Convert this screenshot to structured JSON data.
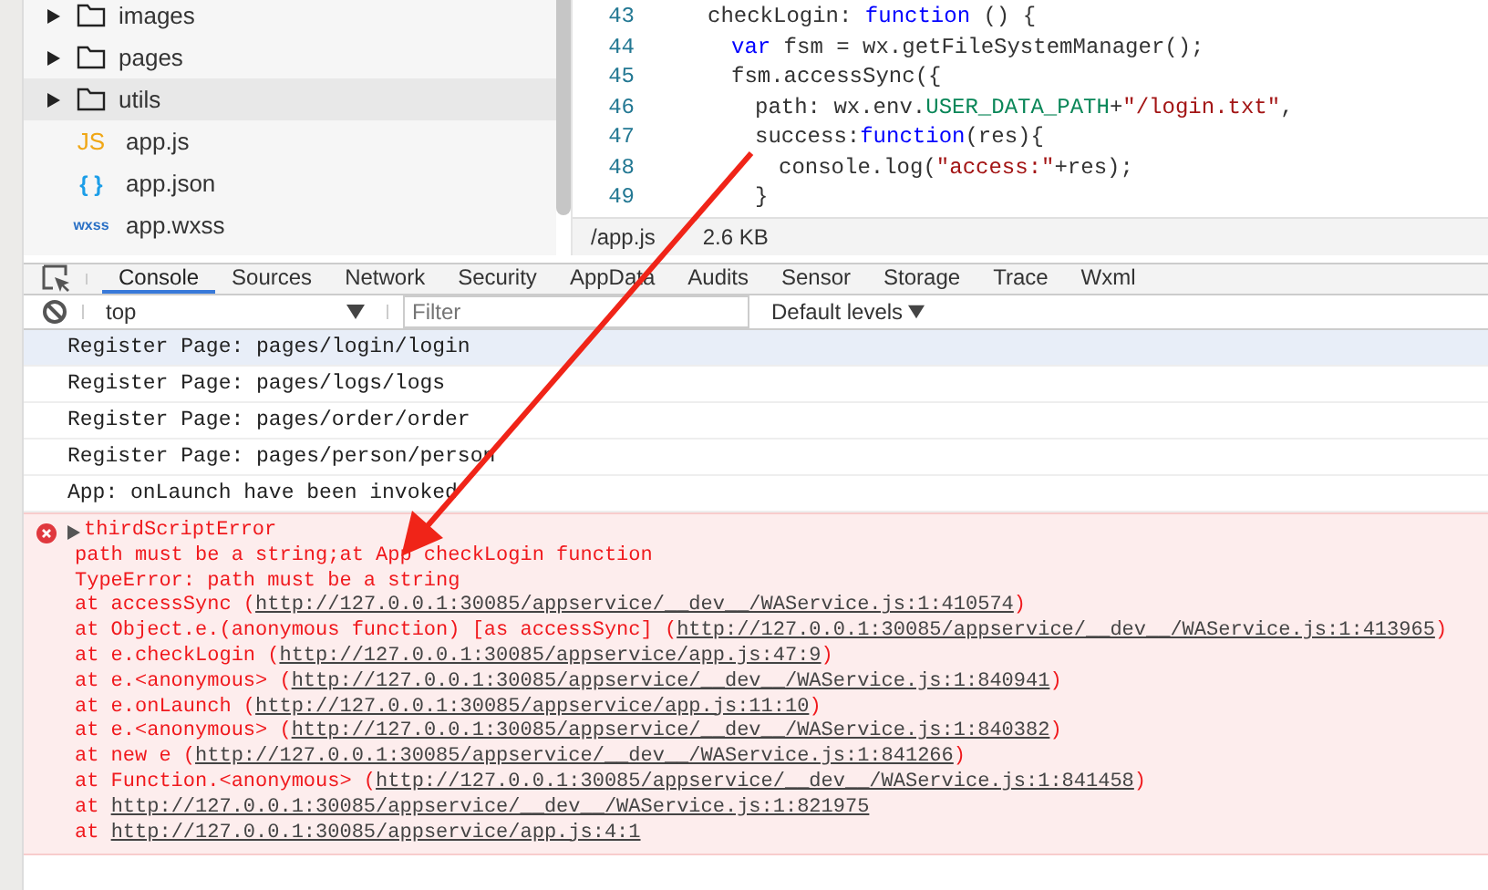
{
  "file_tree": [
    {
      "kind": "folder",
      "name": "images",
      "expanded": false,
      "selected": false
    },
    {
      "kind": "folder",
      "name": "pages",
      "expanded": false,
      "selected": false
    },
    {
      "kind": "folder",
      "name": "utils",
      "expanded": false,
      "selected": true
    },
    {
      "kind": "js",
      "name": "app.js",
      "badge": "JS",
      "selected": false
    },
    {
      "kind": "json",
      "name": "app.json",
      "badge": "{ }",
      "selected": false
    },
    {
      "kind": "wxss",
      "name": "app.wxss",
      "badge": "wxss",
      "selected": false
    }
  ],
  "editor": {
    "lines": [
      {
        "number": "43",
        "segments": [
          {
            "kind": "plain",
            "text": "checkLogin: "
          },
          {
            "kind": "keyword",
            "text": "function"
          },
          {
            "kind": "plain",
            "text": " () {"
          }
        ],
        "children": [
          {
            "number": "44",
            "segments": [
              {
                "kind": "keyword",
                "text": "var"
              },
              {
                "kind": "plain",
                "text": " fsm = wx.getFileSystemManager();"
              }
            ]
          },
          {
            "number": "45",
            "segments": [
              {
                "kind": "plain",
                "text": "fsm.accessSync({"
              }
            ],
            "children": [
              {
                "number": "46",
                "segments": [
                  {
                    "kind": "plain",
                    "text": "path: wx.env."
                  },
                  {
                    "kind": "constant",
                    "text": "USER_DATA_PATH"
                  },
                  {
                    "kind": "plain",
                    "text": "+"
                  },
                  {
                    "kind": "string",
                    "text": "\"/login.txt\""
                  },
                  {
                    "kind": "plain",
                    "text": ","
                  }
                ]
              },
              {
                "number": "47",
                "segments": [
                  {
                    "kind": "plain",
                    "text": "success:"
                  },
                  {
                    "kind": "keyword",
                    "text": "function"
                  },
                  {
                    "kind": "plain",
                    "text": "(res){"
                  }
                ],
                "children": [
                  {
                    "number": "48",
                    "segments": [
                      {
                        "kind": "plain",
                        "text": "console.log("
                      },
                      {
                        "kind": "string",
                        "text": "\"access:\""
                      },
                      {
                        "kind": "plain",
                        "text": "+res);"
                      }
                    ]
                  }
                ]
              },
              {
                "number": "49",
                "segments": [
                  {
                    "kind": "plain",
                    "text": "}"
                  }
                ]
              }
            ]
          }
        ]
      }
    ],
    "status_bar": {
      "path": "/app.js",
      "size": "2.6 KB"
    }
  },
  "devtools_tabs": [
    {
      "label": "Console",
      "selected": true
    },
    {
      "label": "Sources",
      "selected": false
    },
    {
      "label": "Network",
      "selected": false
    },
    {
      "label": "Security",
      "selected": false
    },
    {
      "label": "AppData",
      "selected": false
    },
    {
      "label": "Audits",
      "selected": false
    },
    {
      "label": "Sensor",
      "selected": false
    },
    {
      "label": "Storage",
      "selected": false
    },
    {
      "label": "Trace",
      "selected": false
    },
    {
      "label": "Wxml",
      "selected": false
    }
  ],
  "console_toolbar": {
    "context": "top",
    "filter_placeholder": "Filter",
    "levels": "Default levels"
  },
  "console_messages": [
    {
      "kind": "log",
      "text": "Register Page: pages/login/login",
      "selected": true
    },
    {
      "kind": "log",
      "text": "Register Page: pages/logs/logs",
      "selected": false
    },
    {
      "kind": "log",
      "text": "Register Page: pages/order/order",
      "selected": false
    },
    {
      "kind": "log",
      "text": "Register Page: pages/person/person",
      "selected": false
    },
    {
      "kind": "log",
      "text": "App: onLaunch have been invoked",
      "selected": false
    },
    {
      "kind": "error",
      "title": "thirdScriptError",
      "message": "path must be a string;at App checkLogin function",
      "error": "TypeError: path must be a string",
      "frames": [
        {
          "at": "at",
          "prefix": "accessSync (",
          "url": "http://127.0.0.1:30085/appservice/__dev__/WAService.js:1:410574",
          "suffix": ")"
        },
        {
          "at": "at",
          "prefix": "Object.e.(anonymous function) [as accessSync] (",
          "url": "http://127.0.0.1:30085/appservice/__dev__/WAService.js:1:413965",
          "suffix": ")"
        },
        {
          "at": "at",
          "prefix": "e.checkLogin (",
          "url": "http://127.0.0.1:30085/appservice/app.js:47:9",
          "suffix": ")"
        },
        {
          "at": "at",
          "prefix": "e.<anonymous> (",
          "url": "http://127.0.0.1:30085/appservice/__dev__/WAService.js:1:840941",
          "suffix": ")"
        },
        {
          "at": "at",
          "prefix": "e.onLaunch (",
          "url": "http://127.0.0.1:30085/appservice/app.js:11:10",
          "suffix": ")"
        },
        {
          "at": "at",
          "prefix": "e.<anonymous> (",
          "url": "http://127.0.0.1:30085/appservice/__dev__/WAService.js:1:840382",
          "suffix": ")"
        },
        {
          "at": "at",
          "prefix": "new e (",
          "url": "http://127.0.0.1:30085/appservice/__dev__/WAService.js:1:841266",
          "suffix": ")"
        },
        {
          "at": "at",
          "prefix": "Function.<anonymous> (",
          "url": "http://127.0.0.1:30085/appservice/__dev__/WAService.js:1:841458",
          "suffix": ")"
        },
        {
          "at": "at",
          "url": "http://127.0.0.1:30085/appservice/__dev__/WAService.js:1:821975"
        },
        {
          "at": "at",
          "url": "http://127.0.0.1:30085/appservice/app.js:4:1"
        }
      ]
    }
  ]
}
